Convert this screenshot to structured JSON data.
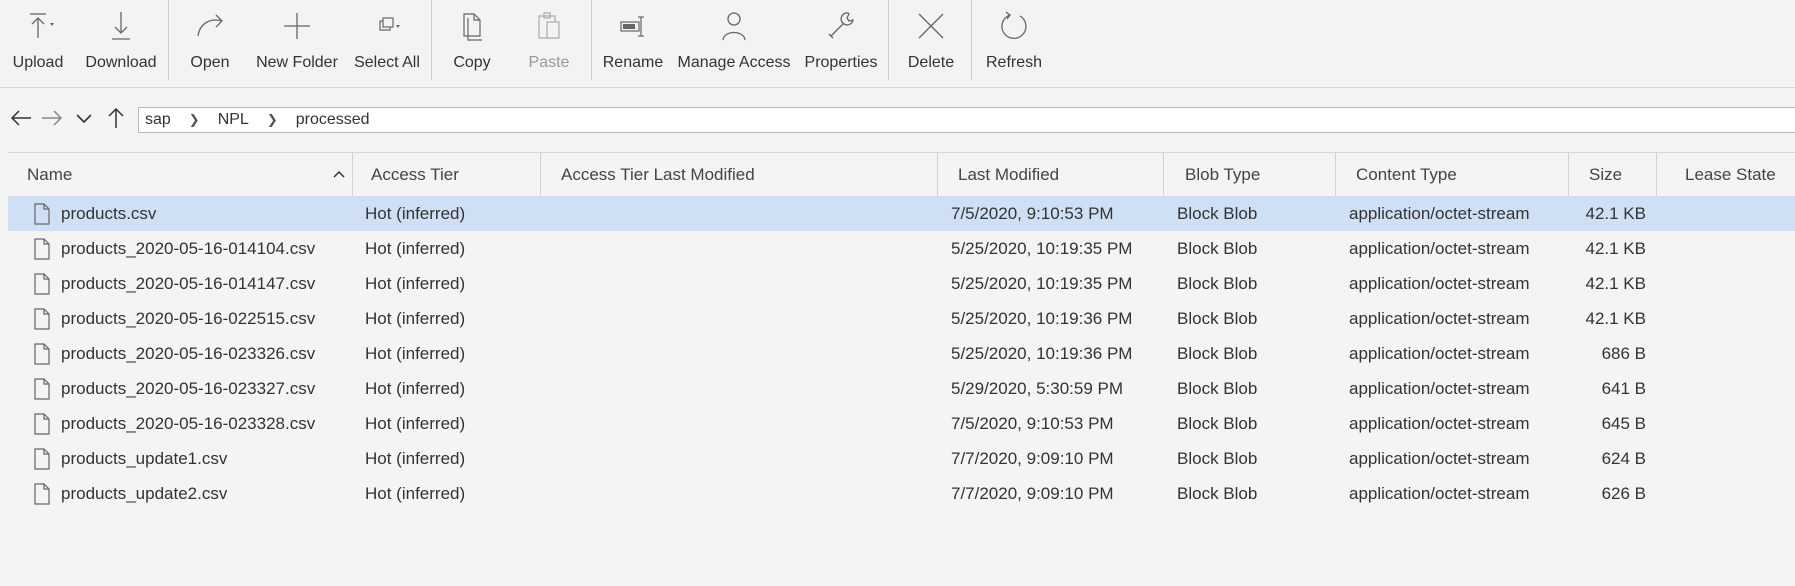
{
  "toolbar": {
    "upload": "Upload",
    "download": "Download",
    "open": "Open",
    "new_folder": "New Folder",
    "select_all": "Select All",
    "copy": "Copy",
    "paste": "Paste",
    "rename": "Rename",
    "manage_access": "Manage Access",
    "properties": "Properties",
    "delete": "Delete",
    "refresh": "Refresh"
  },
  "breadcrumb": [
    "sap",
    "NPL",
    "processed"
  ],
  "columns": {
    "name": "Name",
    "access_tier": "Access Tier",
    "access_tier_last_modified": "Access Tier Last Modified",
    "last_modified": "Last Modified",
    "blob_type": "Blob Type",
    "content_type": "Content Type",
    "size": "Size",
    "lease_state": "Lease State"
  },
  "rows": [
    {
      "name": "products.csv",
      "tier": "Hot (inferred)",
      "tier_mod": "",
      "modified": "7/5/2020, 9:10:53 PM",
      "blob": "Block Blob",
      "ctype": "application/octet-stream",
      "size": "42.1 KB",
      "lease": "",
      "selected": true
    },
    {
      "name": "products_2020-05-16-014104.csv",
      "tier": "Hot (inferred)",
      "tier_mod": "",
      "modified": "5/25/2020, 10:19:35 PM",
      "blob": "Block Blob",
      "ctype": "application/octet-stream",
      "size": "42.1 KB",
      "lease": "",
      "selected": false
    },
    {
      "name": "products_2020-05-16-014147.csv",
      "tier": "Hot (inferred)",
      "tier_mod": "",
      "modified": "5/25/2020, 10:19:35 PM",
      "blob": "Block Blob",
      "ctype": "application/octet-stream",
      "size": "42.1 KB",
      "lease": "",
      "selected": false
    },
    {
      "name": "products_2020-05-16-022515.csv",
      "tier": "Hot (inferred)",
      "tier_mod": "",
      "modified": "5/25/2020, 10:19:36 PM",
      "blob": "Block Blob",
      "ctype": "application/octet-stream",
      "size": "42.1 KB",
      "lease": "",
      "selected": false
    },
    {
      "name": "products_2020-05-16-023326.csv",
      "tier": "Hot (inferred)",
      "tier_mod": "",
      "modified": "5/25/2020, 10:19:36 PM",
      "blob": "Block Blob",
      "ctype": "application/octet-stream",
      "size": "686 B",
      "lease": "",
      "selected": false
    },
    {
      "name": "products_2020-05-16-023327.csv",
      "tier": "Hot (inferred)",
      "tier_mod": "",
      "modified": "5/29/2020, 5:30:59 PM",
      "blob": "Block Blob",
      "ctype": "application/octet-stream",
      "size": "641 B",
      "lease": "",
      "selected": false
    },
    {
      "name": "products_2020-05-16-023328.csv",
      "tier": "Hot (inferred)",
      "tier_mod": "",
      "modified": "7/5/2020, 9:10:53 PM",
      "blob": "Block Blob",
      "ctype": "application/octet-stream",
      "size": "645 B",
      "lease": "",
      "selected": false
    },
    {
      "name": "products_update1.csv",
      "tier": "Hot (inferred)",
      "tier_mod": "",
      "modified": "7/7/2020, 9:09:10 PM",
      "blob": "Block Blob",
      "ctype": "application/octet-stream",
      "size": "624 B",
      "lease": "",
      "selected": false
    },
    {
      "name": "products_update2.csv",
      "tier": "Hot (inferred)",
      "tier_mod": "",
      "modified": "7/7/2020, 9:09:10 PM",
      "blob": "Block Blob",
      "ctype": "application/octet-stream",
      "size": "626 B",
      "lease": "",
      "selected": false
    }
  ],
  "colors": {
    "selected_row": "#cfe0f5",
    "icon": "#666666",
    "disabled_icon": "#aaaaaa"
  }
}
